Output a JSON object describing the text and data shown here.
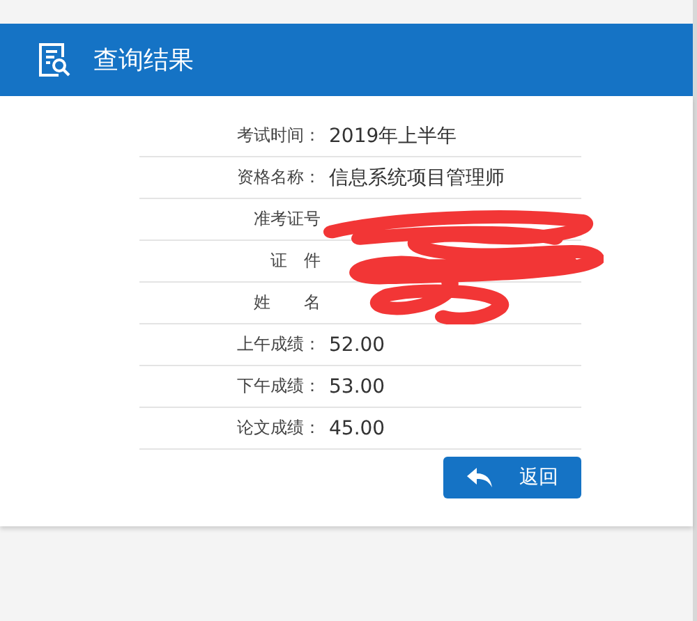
{
  "header": {
    "title": "查询结果"
  },
  "rows": [
    {
      "label": "考试时间：",
      "value": "2019年上半年"
    },
    {
      "label": "资格名称：",
      "value": "信息系统项目管理师"
    },
    {
      "label": "准考证号"
    },
    {
      "label": "证　件"
    },
    {
      "label": "姓　　名"
    },
    {
      "label": "上午成绩：",
      "value": "52.00"
    },
    {
      "label": "下午成绩：",
      "value": "53.00"
    },
    {
      "label": "论文成绩：",
      "value": "45.00"
    }
  ],
  "button": {
    "label": "返回"
  }
}
